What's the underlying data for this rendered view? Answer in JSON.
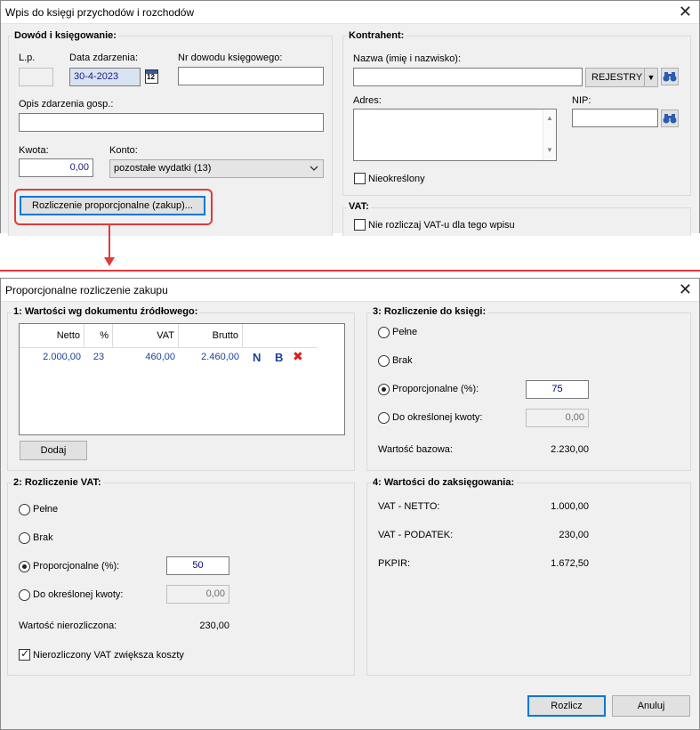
{
  "top_dialog": {
    "title": "Wpis do księgi przychodów i rozchodów",
    "close": "✕",
    "dowod": {
      "group_title": "Dowód i księgowanie:",
      "lp_label": "L.p.",
      "lp_value": "",
      "date_label": "Data zdarzenia:",
      "date_value": "30-4-2023",
      "calendar_icon_text": "12",
      "nr_label": "Nr dowodu księgowego:",
      "nr_value": "",
      "opis_label": "Opis zdarzenia gosp.:",
      "opis_value": "",
      "kwota_label": "Kwota:",
      "kwota_value": "0,00",
      "konto_label": "Konto:",
      "konto_value": "pozostałe wydatki (13)",
      "prop_button": "Rozliczenie proporcjonalne (zakup)..."
    },
    "kontrahent": {
      "group_title": "Kontrahent:",
      "nazwa_label": "Nazwa (imię i nazwisko):",
      "nazwa_value": "",
      "rejestry_button": "REJESTRY",
      "adres_label": "Adres:",
      "nip_label": "NIP:",
      "nip_value": "",
      "nieokreslony_label": "Nieokreślony"
    },
    "vat": {
      "group_title": "VAT:",
      "nie_rozliczaj_label": "Nie rozliczaj VAT-u dla tego wpisu"
    }
  },
  "colors": {
    "highlight": "#e03b3b",
    "value_blue": "#1f3f9e",
    "default_border": "#0078d7"
  },
  "dialog": {
    "title": "Proporcjonalne rozliczenie zakupu",
    "close": "✕",
    "section1": {
      "title": "1: Wartości wg dokumentu źródłowego:",
      "columns": [
        "Netto",
        "%",
        "VAT",
        "Brutto"
      ],
      "rows": [
        {
          "netto": "2.000,00",
          "pct": "23",
          "vat": "460,00",
          "brutto": "2.460,00"
        }
      ],
      "row_icons": [
        "N",
        "B",
        "✖"
      ],
      "dodaj_button": "Dodaj"
    },
    "section2": {
      "title": "2: Rozliczenie VAT:",
      "pelne": "Pełne",
      "brak": "Brak",
      "proporcjonalne": "Proporcjonalne (%):",
      "proporcjonalne_value": "50",
      "do_kwoty": "Do określonej kwoty:",
      "do_kwoty_value": "0,00",
      "nierozliczona_label": "Wartość nierozliczona:",
      "nierozliczona_value": "230,00",
      "zwieksza_label": "Nierozliczony VAT zwiększa koszty",
      "selected": "proporcjonalne",
      "zwieksza_checked": true
    },
    "section3": {
      "title": "3: Rozliczenie do księgi:",
      "pelne": "Pełne",
      "brak": "Brak",
      "proporcjonalne": "Proporcjonalne (%):",
      "proporcjonalne_value": "75",
      "do_kwoty": "Do określonej kwoty:",
      "do_kwoty_value": "0,00",
      "bazowa_label": "Wartość bazowa:",
      "bazowa_value": "2.230,00",
      "selected": "proporcjonalne"
    },
    "section4": {
      "title": "4: Wartości do zaksięgowania:",
      "rows": [
        {
          "label": "VAT - NETTO:",
          "value": "1.000,00"
        },
        {
          "label": "VAT - PODATEK:",
          "value": "230,00"
        },
        {
          "label": "PKPIR:",
          "value": "1.672,50"
        }
      ]
    },
    "rozlicz_button": "Rozlicz",
    "anuluj_button": "Anuluj"
  }
}
